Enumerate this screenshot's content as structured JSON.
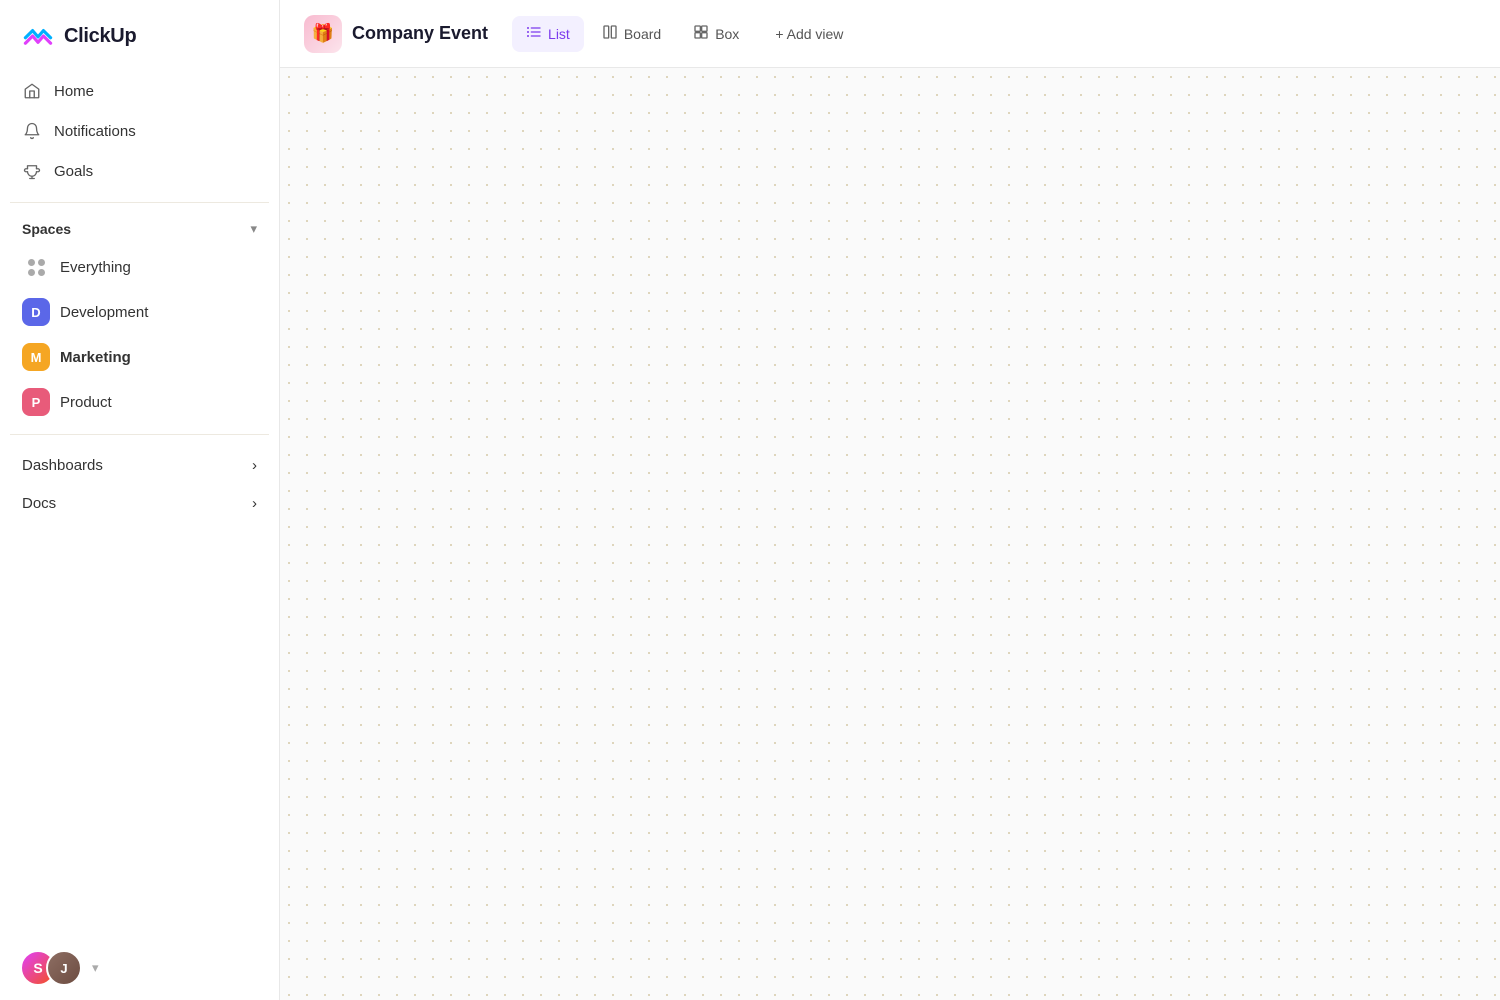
{
  "logo": {
    "text": "ClickUp"
  },
  "sidebar": {
    "nav": [
      {
        "id": "home",
        "label": "Home",
        "icon": "home"
      },
      {
        "id": "notifications",
        "label": "Notifications",
        "icon": "bell"
      },
      {
        "id": "goals",
        "label": "Goals",
        "icon": "trophy"
      }
    ],
    "spaces_title": "Spaces",
    "spaces": [
      {
        "id": "everything",
        "label": "Everything",
        "type": "dots"
      },
      {
        "id": "development",
        "label": "Development",
        "color": "#5b67e8",
        "letter": "D"
      },
      {
        "id": "marketing",
        "label": "Marketing",
        "color": "#f5a623",
        "letter": "M",
        "active": true
      },
      {
        "id": "product",
        "label": "Product",
        "color": "#e85b7a",
        "letter": "P"
      }
    ],
    "sections": [
      {
        "id": "dashboards",
        "label": "Dashboards"
      },
      {
        "id": "docs",
        "label": "Docs"
      }
    ]
  },
  "topbar": {
    "project_icon": "🎁",
    "project_name": "Company Event",
    "tabs": [
      {
        "id": "list",
        "label": "List",
        "icon": "☰",
        "active": true
      },
      {
        "id": "board",
        "label": "Board",
        "icon": "⊞"
      },
      {
        "id": "box",
        "label": "Box",
        "icon": "⊡"
      }
    ],
    "add_view_label": "+ Add view"
  },
  "avatar": {
    "initial": "S"
  }
}
